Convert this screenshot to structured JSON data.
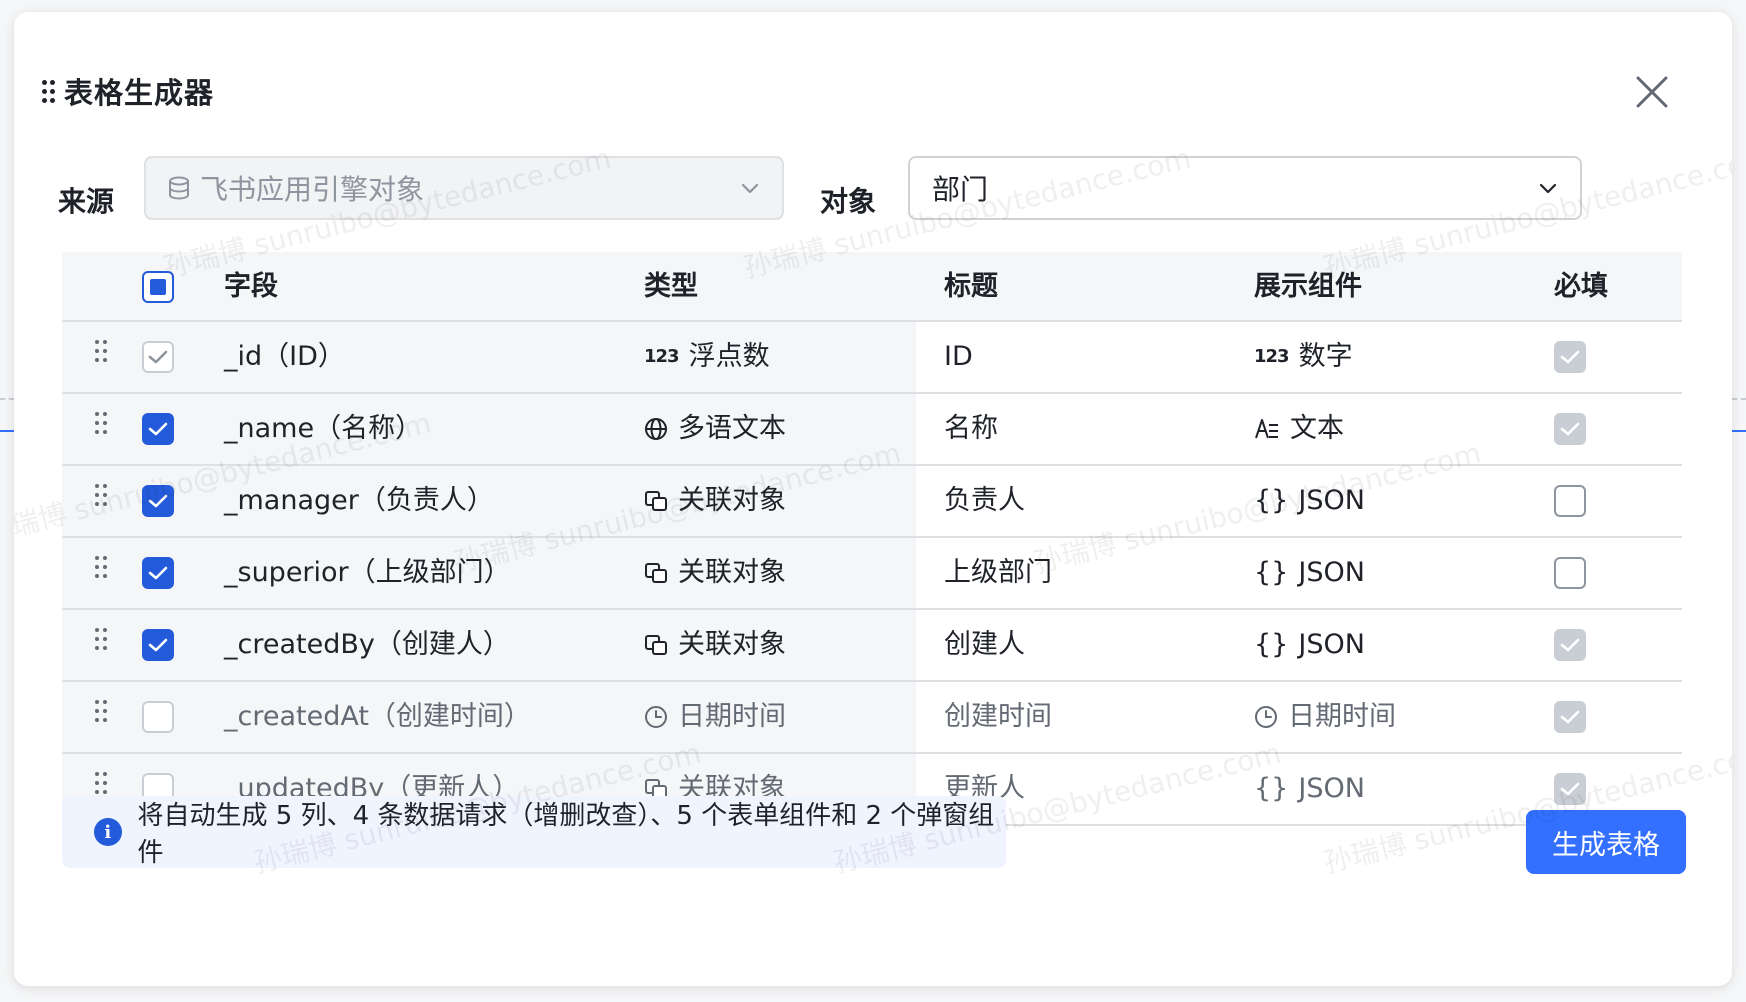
{
  "dialog": {
    "title": "表格生成器",
    "source_label": "来源",
    "source_value": "飞书应用引擎对象",
    "object_label": "对象",
    "object_value": "部门"
  },
  "table": {
    "headers": {
      "field": "字段",
      "type": "类型",
      "title": "标题",
      "component": "展示组件",
      "required": "必填"
    },
    "select_all_state": "partial",
    "rows": [
      {
        "field": "_id（ID）",
        "type_icon": "123",
        "type": "浮点数",
        "title": "ID",
        "comp_icon": "123",
        "component": "数字",
        "selected": "checked-disabled",
        "required": "grey-checked",
        "muted": false
      },
      {
        "field": "_name（名称）",
        "type_icon": "globe-icon",
        "type": "多语文本",
        "title": "名称",
        "comp_icon": "text-icon",
        "component": "文本",
        "selected": "checked",
        "required": "grey-checked",
        "muted": false
      },
      {
        "field": "_manager（负责人）",
        "type_icon": "link-object-icon",
        "type": "关联对象",
        "title": "负责人",
        "comp_icon": "{}",
        "component": "JSON",
        "selected": "checked",
        "required": "unchecked",
        "muted": false
      },
      {
        "field": "_superior（上级部门）",
        "type_icon": "link-object-icon",
        "type": "关联对象",
        "title": "上级部门",
        "comp_icon": "{}",
        "component": "JSON",
        "selected": "checked",
        "required": "unchecked",
        "muted": false
      },
      {
        "field": "_createdBy（创建人）",
        "type_icon": "link-object-icon",
        "type": "关联对象",
        "title": "创建人",
        "comp_icon": "{}",
        "component": "JSON",
        "selected": "checked",
        "required": "grey-checked",
        "muted": false
      },
      {
        "field": "_createdAt（创建时间）",
        "type_icon": "clock-icon",
        "type": "日期时间",
        "title": "创建时间",
        "comp_icon": "clock-icon",
        "component": "日期时间",
        "selected": "unchecked",
        "required": "grey-checked",
        "muted": true
      },
      {
        "field": "_updatedBy（更新人）",
        "type_icon": "link-object-icon",
        "type": "关联对象",
        "title": "更新人",
        "comp_icon": "{}",
        "component": "JSON",
        "selected": "unchecked",
        "required": "grey-checked",
        "muted": true
      }
    ]
  },
  "info": {
    "text": "将自动生成 5 列、4 条数据请求（增删改查）、5 个表单组件和 2 个弹窗组件"
  },
  "actions": {
    "generate_label": "生成表格"
  },
  "watermark": {
    "text": "孙瑞博 sunruibo@bytedance.com"
  },
  "colors": {
    "primary": "#3370ff",
    "checkbox": "#245bdb",
    "info_bg": "#f0f4ff"
  }
}
